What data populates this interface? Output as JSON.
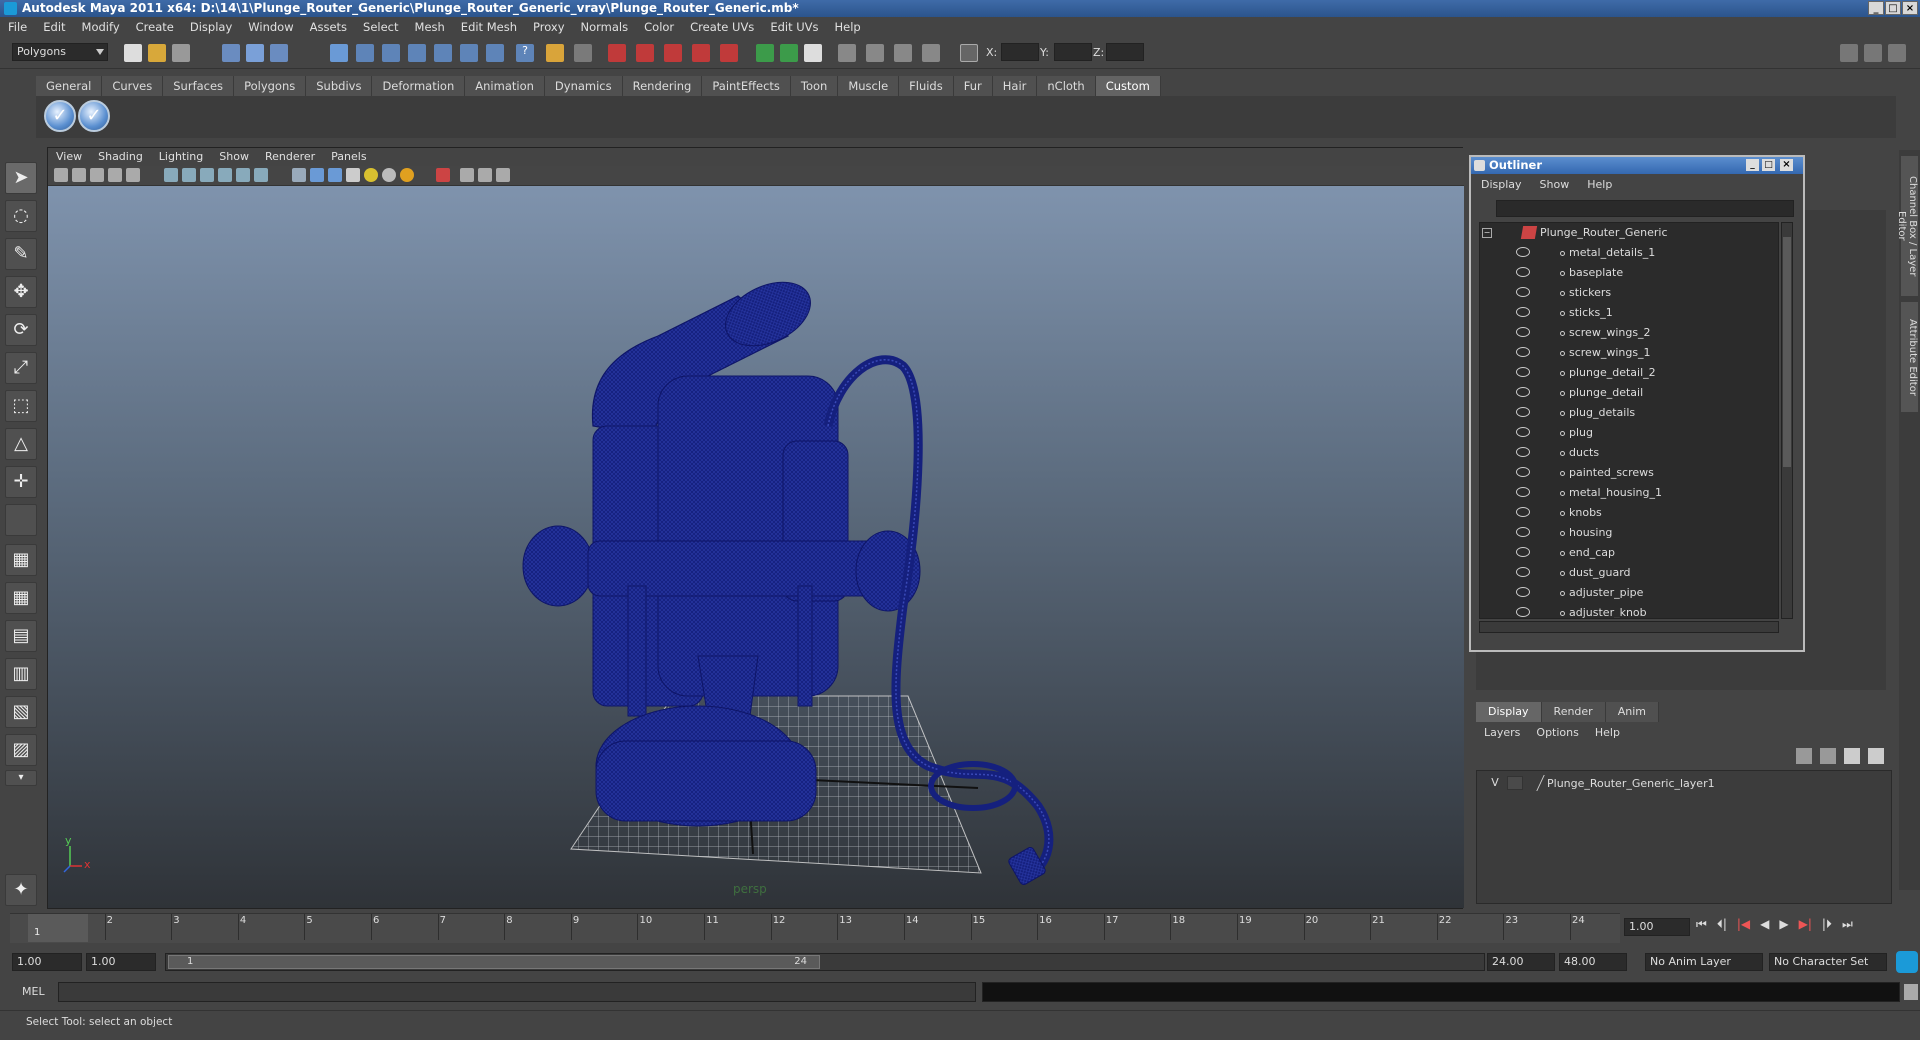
{
  "window": {
    "title": "Autodesk Maya 2011 x64: D:\\14\\1\\Plunge_Router_Generic\\Plunge_Router_Generic_vray\\Plunge_Router_Generic.mb*"
  },
  "menubar": [
    "File",
    "Edit",
    "Modify",
    "Create",
    "Display",
    "Window",
    "Assets",
    "Select",
    "Mesh",
    "Edit Mesh",
    "Proxy",
    "Normals",
    "Color",
    "Create UVs",
    "Edit UVs",
    "Help"
  ],
  "statusline": {
    "menu_set": "Polygons",
    "x_label": "X:",
    "y_label": "Y:",
    "z_label": "Z:"
  },
  "shelf": {
    "tabs": [
      "General",
      "Curves",
      "Surfaces",
      "Polygons",
      "Subdivs",
      "Deformation",
      "Animation",
      "Dynamics",
      "Rendering",
      "PaintEffects",
      "Toon",
      "Muscle",
      "Fluids",
      "Fur",
      "Hair",
      "nCloth",
      "Custom"
    ],
    "active_tab": "Custom"
  },
  "viewport": {
    "menu": [
      "View",
      "Shading",
      "Lighting",
      "Show",
      "Renderer",
      "Panels"
    ],
    "camera_label": "persp",
    "axis_y": "y",
    "axis_x": "x"
  },
  "outliner": {
    "title": "Outliner",
    "menu": [
      "Display",
      "Show",
      "Help"
    ],
    "root": "Plunge_Router_Generic",
    "items": [
      "metal_details_1",
      "baseplate",
      "stickers",
      "sticks_1",
      "screw_wings_2",
      "screw_wings_1",
      "plunge_detail_2",
      "plunge_detail",
      "plug_details",
      "plug",
      "ducts",
      "painted_screws",
      "metal_housing_1",
      "knobs",
      "housing",
      "end_cap",
      "dust_guard",
      "adjuster_pipe",
      "adjuster_knob"
    ]
  },
  "side_tabs": [
    "Channel Box / Layer Editor",
    "Attribute Editor"
  ],
  "layer_editor": {
    "tabs": [
      "Display",
      "Render",
      "Anim"
    ],
    "active_tab": "Display",
    "menu": [
      "Layers",
      "Options",
      "Help"
    ],
    "layers": [
      {
        "visible": "V",
        "name": "Plunge_Router_Generic_layer1"
      }
    ]
  },
  "timeline": {
    "ticks": [
      "1",
      "2",
      "3",
      "4",
      "5",
      "6",
      "7",
      "8",
      "9",
      "10",
      "11",
      "12",
      "13",
      "14",
      "15",
      "16",
      "17",
      "18",
      "19",
      "20",
      "21",
      "22",
      "23",
      "24"
    ],
    "current_frame": "1.00",
    "current_marker": "1"
  },
  "range": {
    "start": "1.00",
    "playback_start": "1.00",
    "slider_start": "1",
    "slider_end": "24",
    "playback_end": "24.00",
    "end": "48.00",
    "anim_layer": "No Anim Layer",
    "character_set": "No Character Set"
  },
  "cmdline": {
    "label": "MEL"
  },
  "helpline": {
    "text": "Select Tool: select an object"
  },
  "colors": {
    "wireframe": "#141c7c",
    "accent": "#3468b0"
  }
}
